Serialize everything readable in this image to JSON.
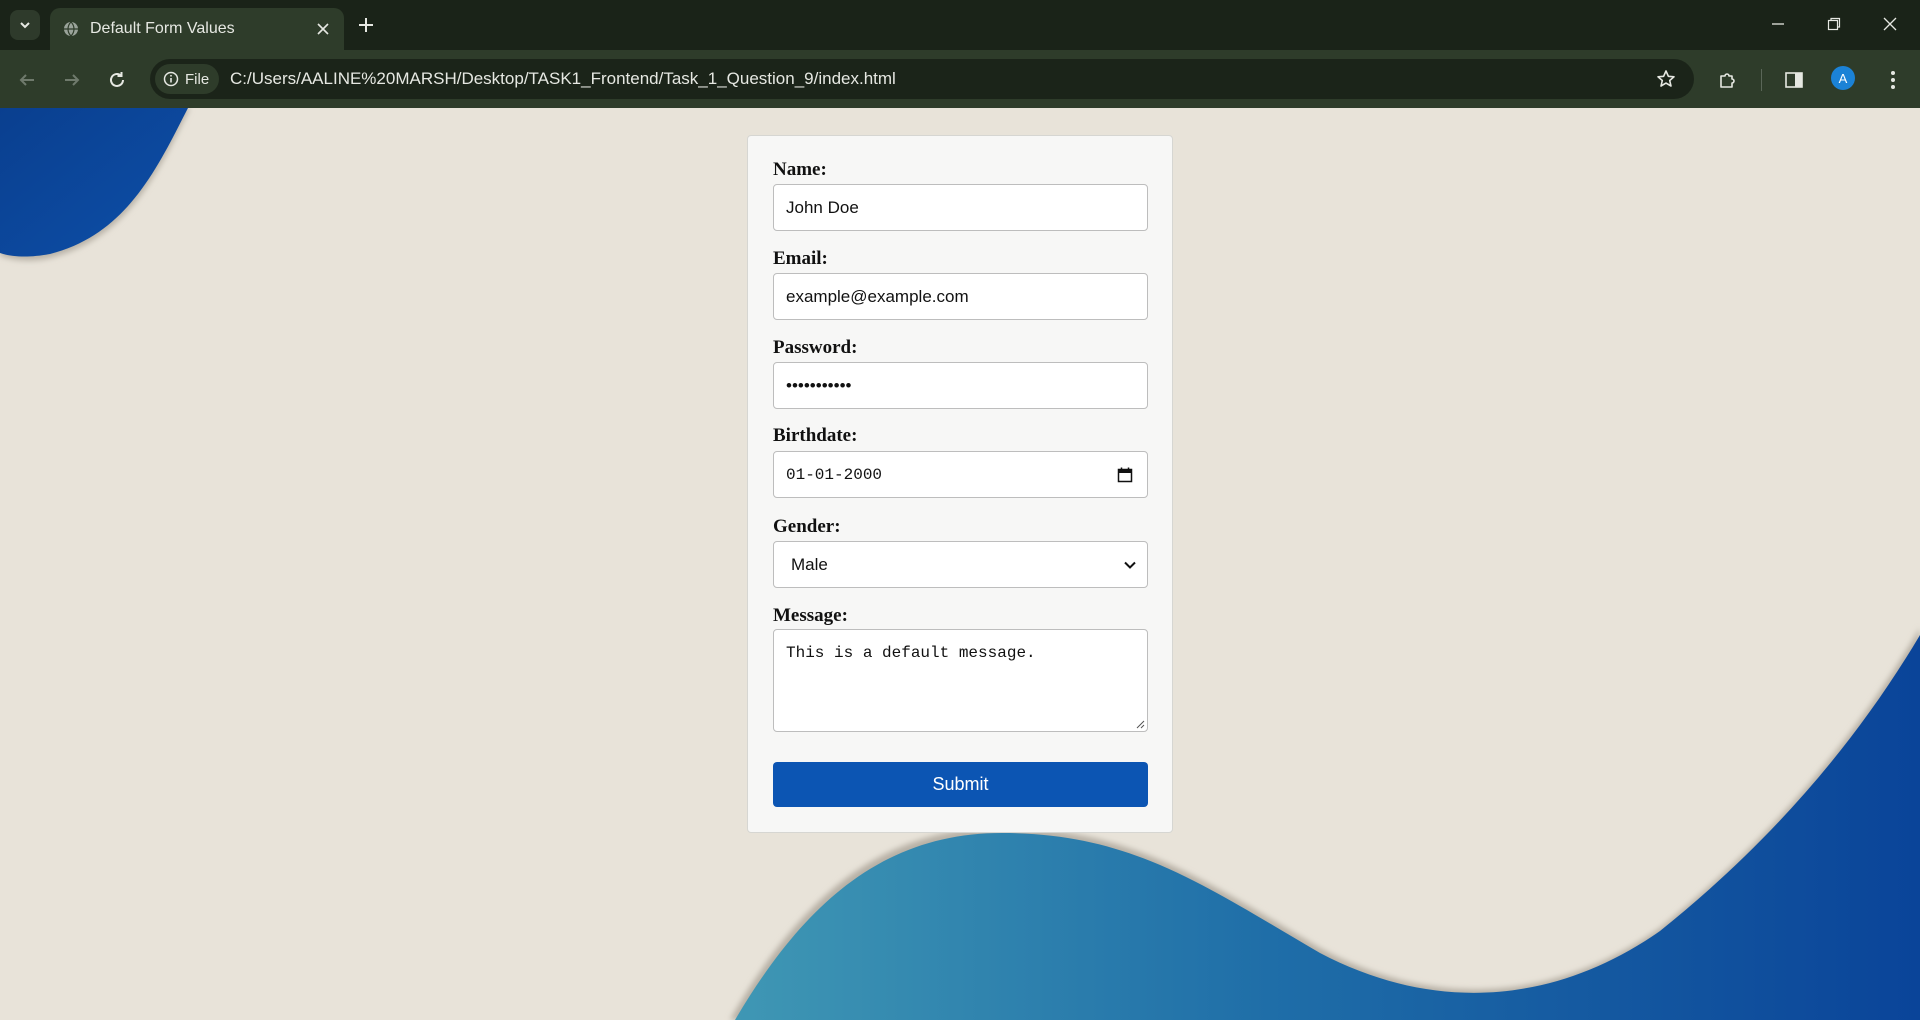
{
  "browser": {
    "tab": {
      "title": "Default Form Values"
    },
    "address_bar": {
      "site_chip_label": "File",
      "url": "C:/Users/AALINE%20MARSH/Desktop/TASK1_Frontend/Task_1_Question_9/index.html"
    },
    "profile_initial": "A",
    "icons": {
      "tab_search": "chevron-down-icon",
      "favicon": "globe-icon",
      "tab_close": "close-icon",
      "new_tab": "plus-icon",
      "back": "arrow-left-icon",
      "forward": "arrow-right-icon",
      "reload": "reload-icon",
      "site_info": "info-icon",
      "bookmark": "star-icon",
      "extensions": "puzzle-icon",
      "side_panel": "side-panel-icon",
      "menu": "kebab-menu-icon"
    }
  },
  "form": {
    "name": {
      "label": "Name:",
      "value": "John Doe"
    },
    "email": {
      "label": "Email:",
      "value": "example@example.com"
    },
    "password": {
      "label": "Password:",
      "masked_value": "•••••••••••"
    },
    "birthdate": {
      "label": "Birthdate:",
      "value": "01-01-2000"
    },
    "gender": {
      "label": "Gender:",
      "selected": "Male"
    },
    "message": {
      "label": "Message:",
      "value": "This is a default message."
    },
    "submit_label": "Submit"
  },
  "colors": {
    "page_background": "#e8e3d9",
    "accent_button": "#0c55b3",
    "chrome_frame": "#1a2318",
    "chrome_toolbar": "#2e3c2a"
  }
}
